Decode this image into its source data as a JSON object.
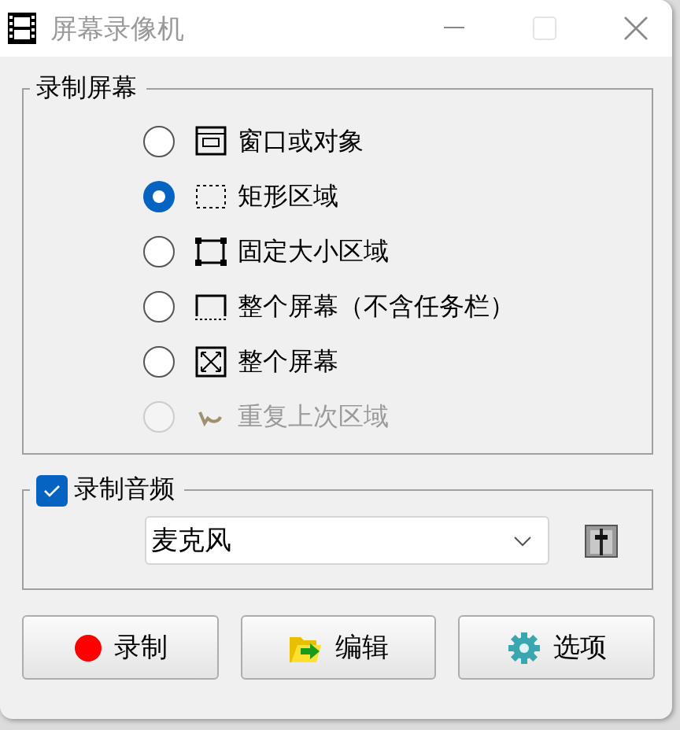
{
  "window": {
    "title": "屏幕录像机"
  },
  "capture_group": {
    "title": "录制屏幕",
    "options": [
      {
        "kind": "window",
        "label": "窗口或对象",
        "selected": false,
        "disabled": false
      },
      {
        "kind": "rectangle",
        "label": "矩形区域",
        "selected": true,
        "disabled": false
      },
      {
        "kind": "fixed",
        "label": "固定大小区域",
        "selected": false,
        "disabled": false
      },
      {
        "kind": "no-taskbar",
        "label": "整个屏幕（不含任务栏）",
        "selected": false,
        "disabled": false
      },
      {
        "kind": "fullscreen",
        "label": "整个屏幕",
        "selected": false,
        "disabled": false
      },
      {
        "kind": "repeat",
        "label": "重复上次区域",
        "selected": false,
        "disabled": true
      }
    ]
  },
  "audio_group": {
    "title": "录制音频",
    "checked": true,
    "device": "麦克风"
  },
  "buttons": [
    {
      "kind": "record",
      "label": "录制"
    },
    {
      "kind": "edit",
      "label": "编辑"
    },
    {
      "kind": "options",
      "label": "选项"
    }
  ]
}
